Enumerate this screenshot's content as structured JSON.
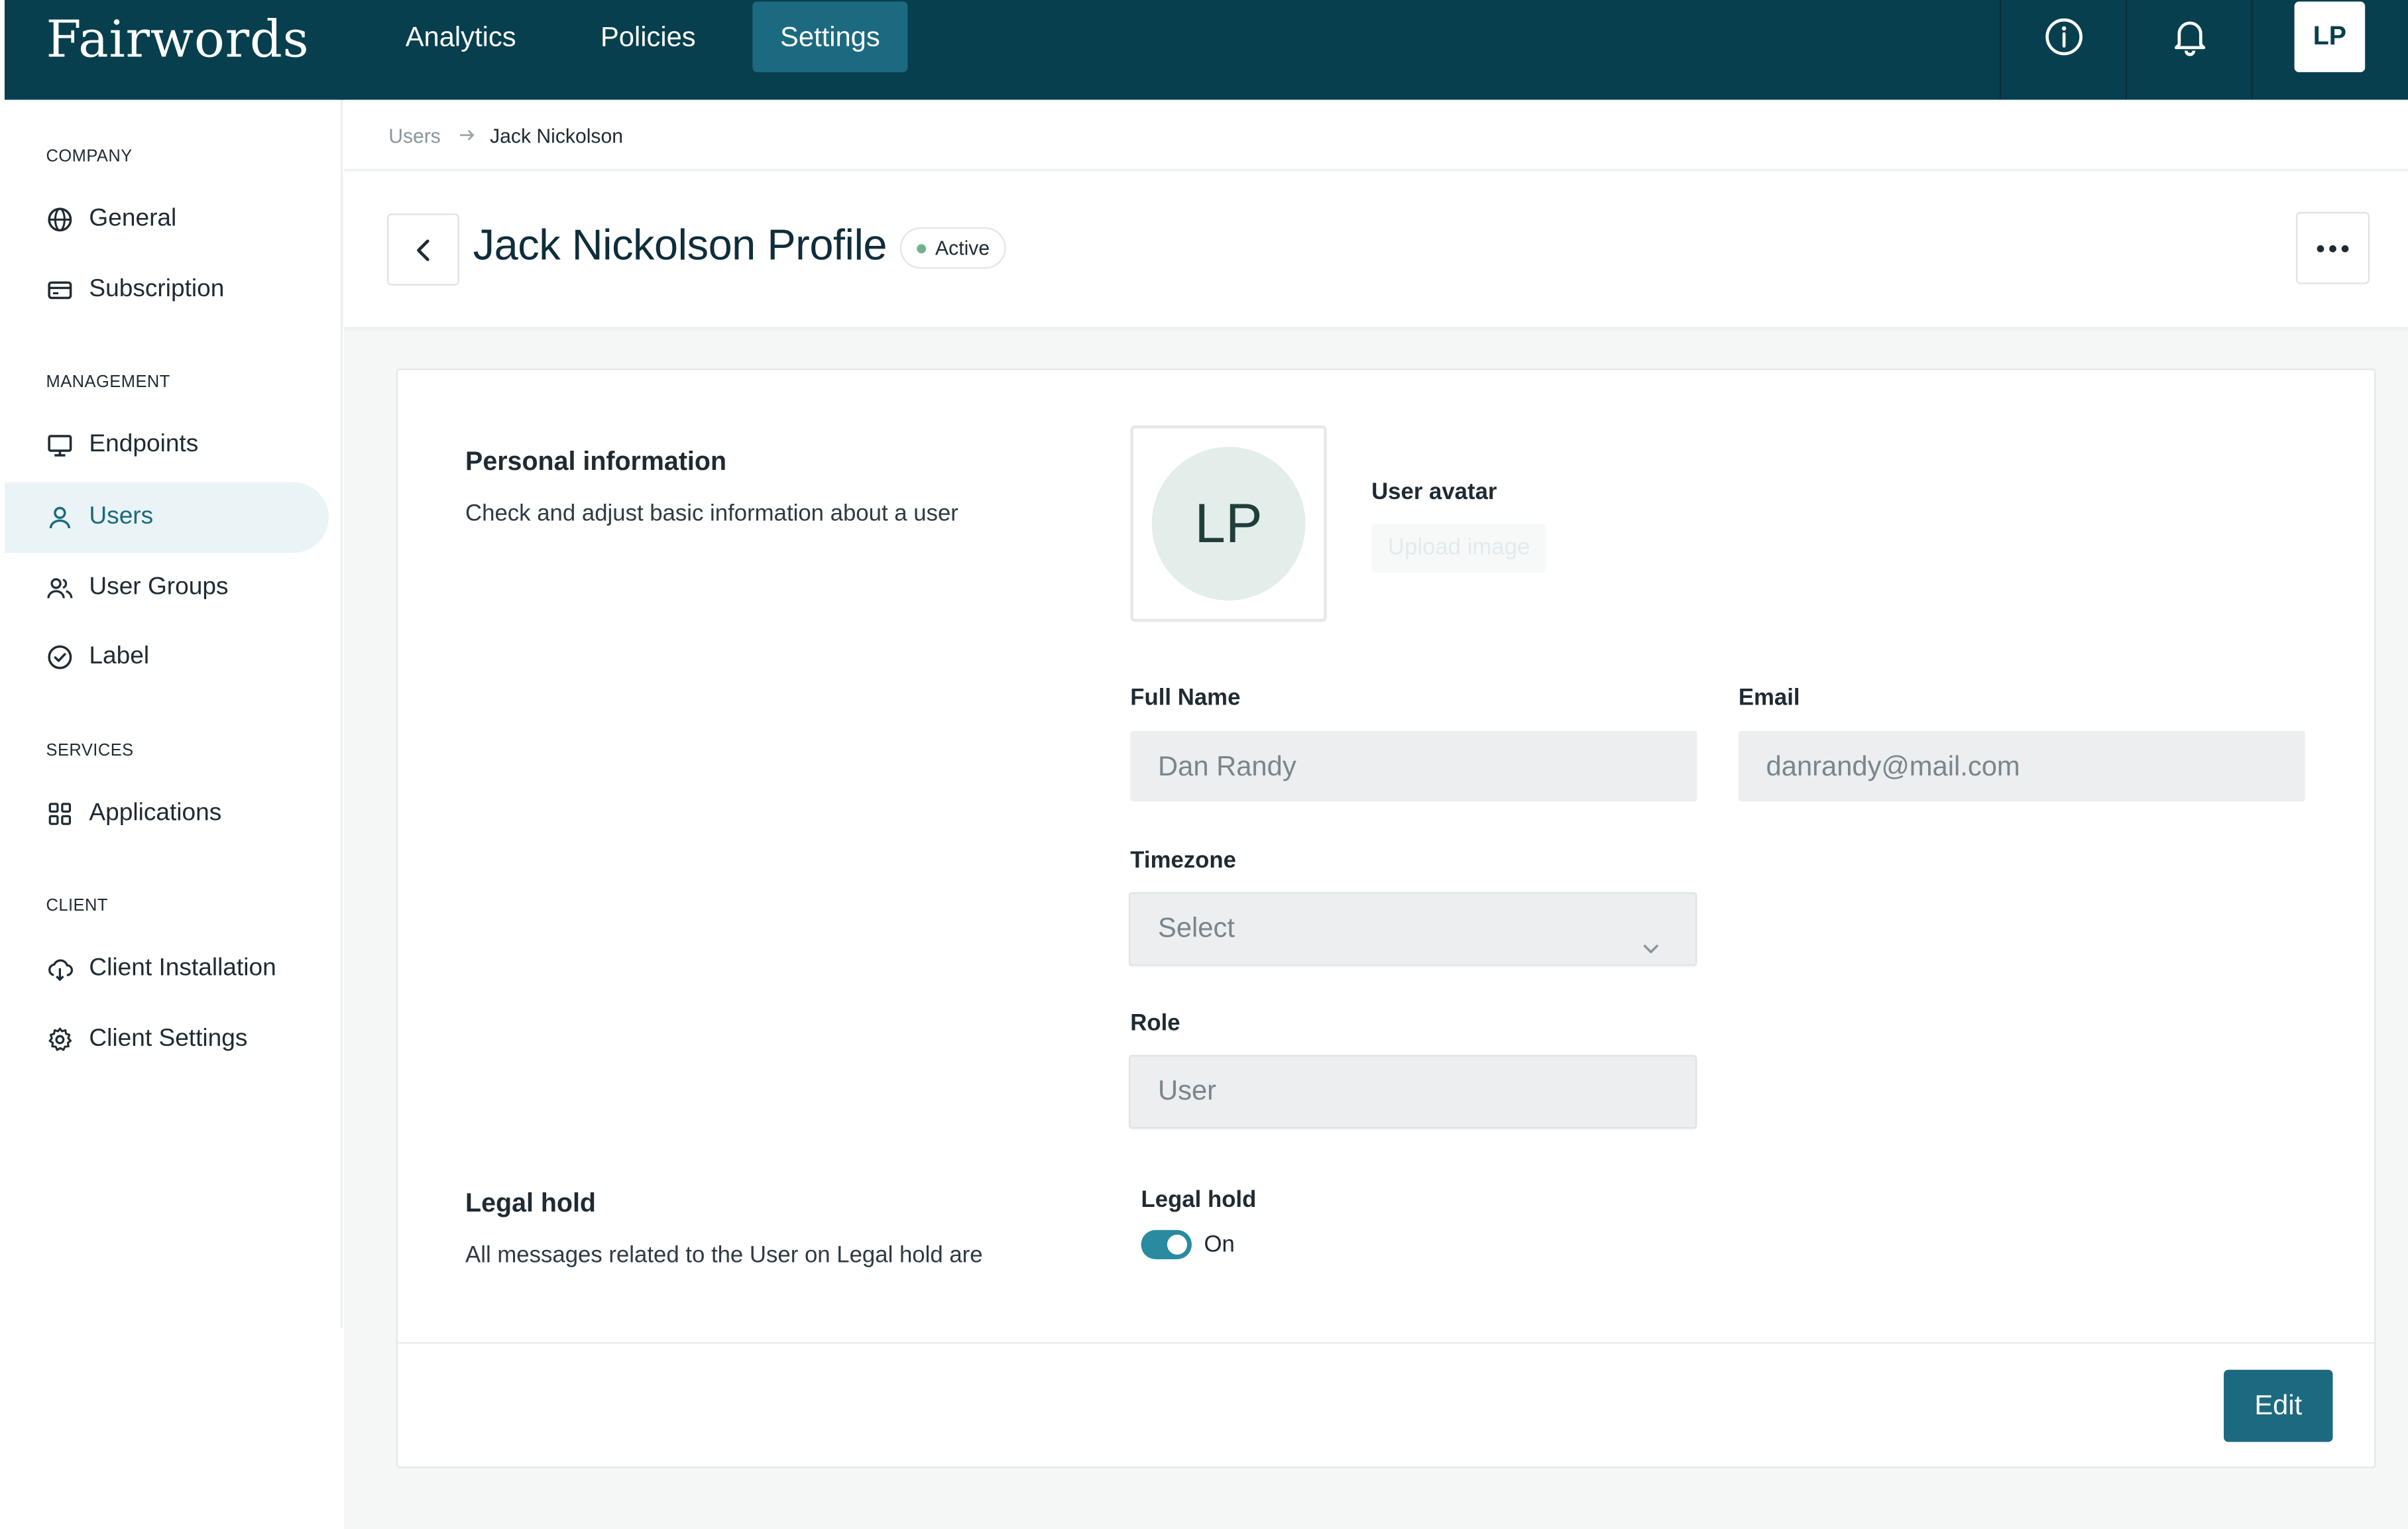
{
  "app": {
    "logo": "Fairwords"
  },
  "topnav": {
    "items": [
      {
        "label": "Analytics",
        "active": false
      },
      {
        "label": "Policies",
        "active": false
      },
      {
        "label": "Settings",
        "active": true
      }
    ],
    "icons": [
      "info-icon",
      "bell-icon"
    ],
    "avatar_initials": "LP"
  },
  "sidebar": {
    "sections": [
      {
        "title": "COMPANY",
        "items": [
          {
            "label": "General",
            "icon": "globe-icon"
          },
          {
            "label": "Subscription",
            "icon": "credit-card-icon"
          }
        ]
      },
      {
        "title": "MANAGEMENT",
        "items": [
          {
            "label": "Endpoints",
            "icon": "monitor-icon"
          },
          {
            "label": "Users",
            "icon": "user-icon",
            "active": true
          },
          {
            "label": "User Groups",
            "icon": "users-icon"
          },
          {
            "label": "Label",
            "icon": "check-circle-icon"
          }
        ]
      },
      {
        "title": "SERVICES",
        "items": [
          {
            "label": "Applications",
            "icon": "grid-icon"
          }
        ]
      },
      {
        "title": "CLIENT",
        "items": [
          {
            "label": "Client Installation",
            "icon": "cloud-download-icon"
          },
          {
            "label": "Client Settings",
            "icon": "gear-icon"
          }
        ]
      }
    ]
  },
  "breadcrumb": {
    "parent": "Users",
    "current": "Jack Nickolson"
  },
  "header": {
    "title": "Jack Nickolson Profile",
    "status": "Active"
  },
  "personal": {
    "title": "Personal information",
    "description": "Check and adjust basic information about a user",
    "avatar_initials": "LP",
    "avatar_label": "User avatar",
    "upload_label": "Upload image",
    "full_name_label": "Full Name",
    "full_name_value": "Dan Randy",
    "email_label": "Email",
    "email_value": "danrandy@mail.com",
    "timezone_label": "Timezone",
    "timezone_value": "Select",
    "role_label": "Role",
    "role_value": "User"
  },
  "legal": {
    "title": "Legal hold",
    "description": "All messages related to the User on Legal hold are",
    "field_label": "Legal hold",
    "toggle_state": "On"
  },
  "actions": {
    "edit_label": "Edit"
  },
  "colors": {
    "topbar": "#073f4e",
    "accent": "#1c6a80",
    "active_dot": "#6fb38a"
  }
}
